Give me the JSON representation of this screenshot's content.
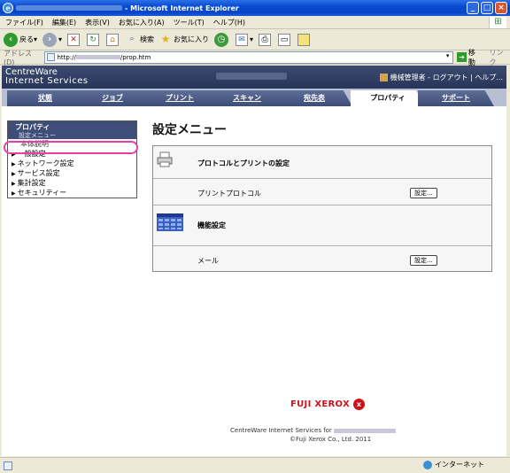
{
  "window": {
    "title": "- Microsoft Internet Explorer",
    "min": "_",
    "max": "□",
    "close": "×"
  },
  "menu": [
    "ファイル(F)",
    "編集(E)",
    "表示(V)",
    "お気に入り(A)",
    "ツール(T)",
    "ヘルプ(H)"
  ],
  "toolbar": {
    "back": "戻る",
    "search": "検索",
    "favorites": "お気に入り"
  },
  "address": {
    "label": "アドレス(D)",
    "url_prefix": "http://",
    "url_suffix": "/prop.htm",
    "go": "移動",
    "links": "リンク"
  },
  "header": {
    "brand_line1": "CentreWare",
    "brand_line2": "Internet Services",
    "user": "機械管理者",
    "links": "- ログアウト | ヘルプ..."
  },
  "tabs": [
    {
      "label": "状態"
    },
    {
      "label": "ジョブ"
    },
    {
      "label": "プリント"
    },
    {
      "label": "スキャン"
    },
    {
      "label": "宛先表"
    },
    {
      "label": "プロパティ"
    },
    {
      "label": "サポート"
    }
  ],
  "nav": {
    "head": "プロパティ",
    "sub": "設定メニュー",
    "selected": "本体説明",
    "items": [
      "一般設定",
      "ネットワーク設定",
      "サービス設定",
      "集計設定",
      "セキュリティー"
    ]
  },
  "main": {
    "title": "設定メニュー",
    "section1_title": "プロトコルとプリントの設定",
    "row1_label": "プリントプロトコル",
    "row1_button": "設定...",
    "section2_title": "機能設定",
    "row2_label": "メール",
    "row2_button": "設定..."
  },
  "footer": {
    "logo": "FUJI XEROX",
    "line1_prefix": "CentreWare Internet Services for",
    "line2": "©Fuji Xerox Co., Ltd. 2011"
  },
  "status": {
    "zone": "インターネット"
  }
}
